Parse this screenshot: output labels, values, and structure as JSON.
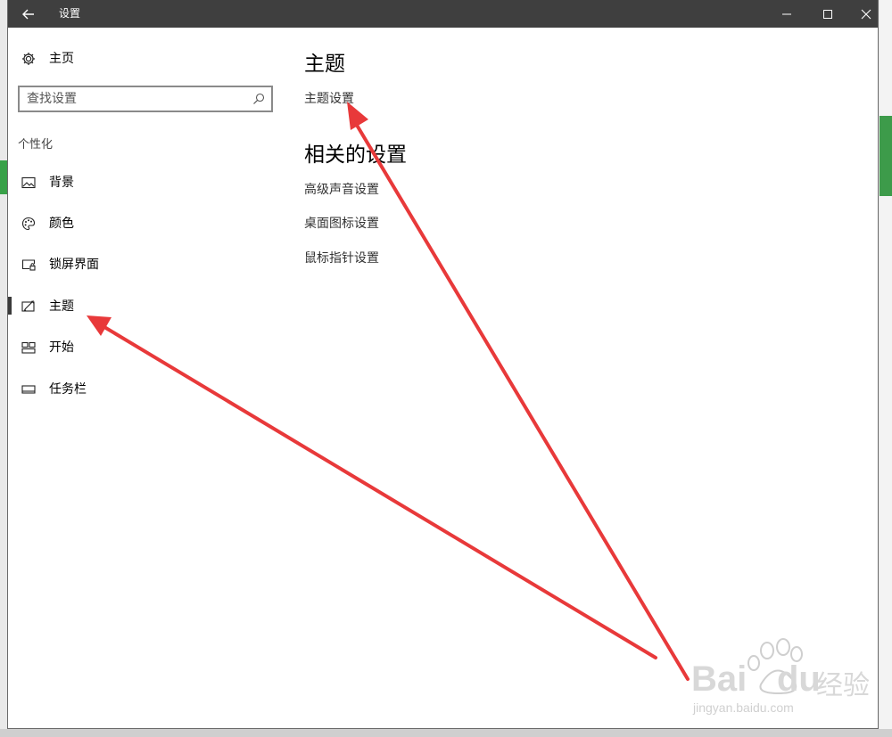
{
  "window": {
    "title": "设置"
  },
  "sidebar": {
    "home_label": "主页",
    "search": {
      "placeholder": "查找设置",
      "value": ""
    },
    "section_label": "个性化",
    "items": [
      {
        "label": "背景",
        "icon": "picture-icon"
      },
      {
        "label": "颜色",
        "icon": "palette-icon"
      },
      {
        "label": "锁屏界面",
        "icon": "lock-screen-icon"
      },
      {
        "label": "主题",
        "icon": "theme-icon",
        "selected": true
      },
      {
        "label": "开始",
        "icon": "start-icon"
      },
      {
        "label": "任务栏",
        "icon": "taskbar-icon"
      }
    ]
  },
  "main": {
    "title": "主题",
    "theme_settings_link": "主题设置",
    "related_title": "相关的设置",
    "related_links": [
      "高级声音设置",
      "桌面图标设置",
      "鼠标指针设置"
    ]
  },
  "watermark": {
    "line1": "Bai",
    "line2": "du",
    "line3": "经验",
    "url": "jingyan.baidu.com"
  },
  "colors": {
    "titlebar": "#3f3f3f",
    "accent_arrow": "#e8393a",
    "selected_indicator": "#3a3a3a"
  }
}
